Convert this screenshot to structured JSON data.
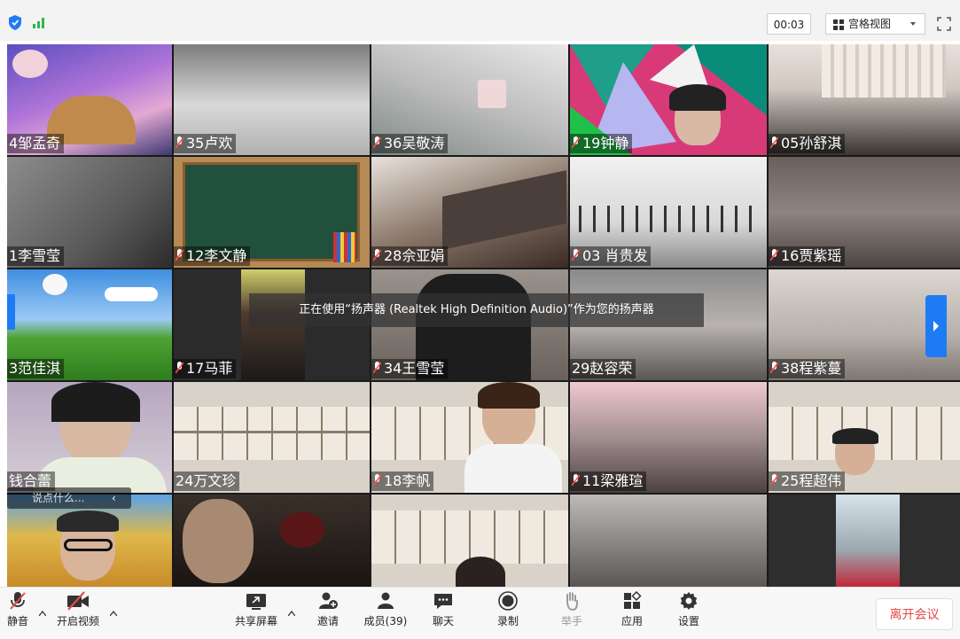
{
  "topbar": {
    "timer": "00:03",
    "view_label": "宫格视图"
  },
  "notice": "正在使用“扬声器 (Realtek High Definition Audio)”作为您的扬声器",
  "chat_input": {
    "placeholder": "说点什么..."
  },
  "participants": [
    "4邹孟奇",
    "35卢欢",
    "36吴敬涛",
    "19钟静",
    "05孙舒淇",
    "1李雪莹",
    "12李文静",
    "28佘亚娟",
    "03 肖贵发",
    "16贾紫瑶",
    "3范佳淇",
    "17马菲",
    "34王雪莹",
    "29赵容荣",
    "38程紫蔓",
    "钱合蕾",
    "24万文珍",
    "18李帆",
    "11梁雅瑄",
    "25程超伟"
  ],
  "toolbar": {
    "mute": "静音",
    "video": "开启视频",
    "share": "共享屏幕",
    "invite": "邀请",
    "members": "成员(39)",
    "chat": "聊天",
    "record": "录制",
    "raise_hand": "举手",
    "apps": "应用",
    "settings": "设置",
    "leave": "离开会议"
  },
  "colors": {
    "accent": "#1e7bf5",
    "leave_text": "#e34a4a",
    "signal": "#2fb84a"
  }
}
